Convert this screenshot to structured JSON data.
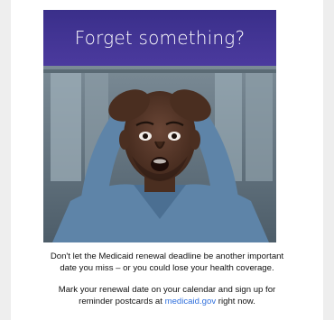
{
  "hero": {
    "title": "Forget something?",
    "photo_alt": "man-holding-head-surprised"
  },
  "body": {
    "paragraph1_line1": "Don't let the Medicaid renewal deadline be another important",
    "paragraph1_line2": "date you miss – or you could lose your health coverage.",
    "paragraph2_line1": "Mark your renewal date on your calendar and sign up for",
    "paragraph2_prefix": "reminder postcards at ",
    "link_text": "medicaid.gov",
    "paragraph2_suffix": " right now."
  },
  "colors": {
    "banner": "#3a2f8a",
    "link": "#2f6fdc",
    "page_background": "#eeeeee"
  }
}
